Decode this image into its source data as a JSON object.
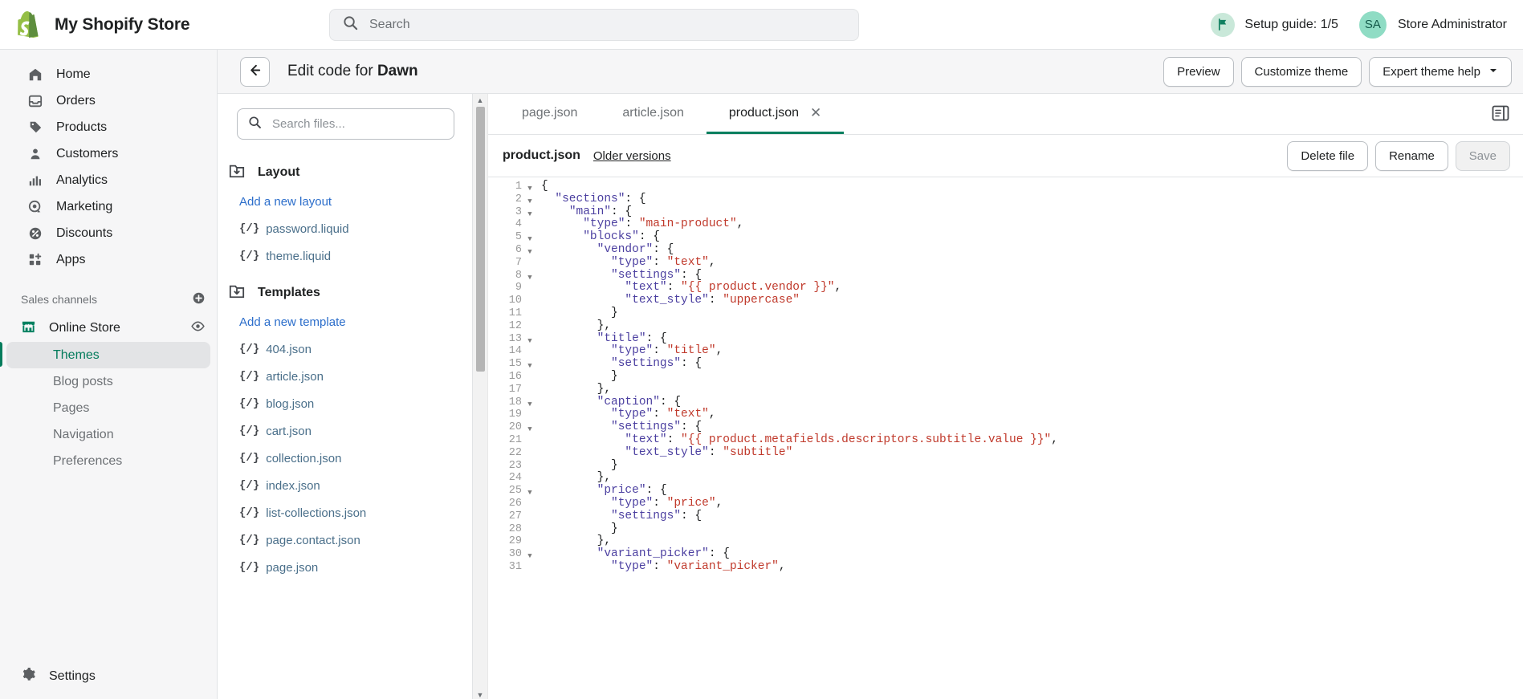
{
  "topbar": {
    "store_name": "My Shopify Store",
    "search_placeholder": "Search",
    "setup_guide_label": "Setup guide: 1/5",
    "avatar_initials": "SA",
    "user_name": "Store Administrator"
  },
  "sidebar": {
    "items": [
      {
        "label": "Home",
        "icon": "home-icon"
      },
      {
        "label": "Orders",
        "icon": "orders-icon"
      },
      {
        "label": "Products",
        "icon": "products-tag-icon"
      },
      {
        "label": "Customers",
        "icon": "customers-icon"
      },
      {
        "label": "Analytics",
        "icon": "analytics-bars-icon"
      },
      {
        "label": "Marketing",
        "icon": "marketing-target-icon"
      },
      {
        "label": "Discounts",
        "icon": "discounts-percent-icon"
      },
      {
        "label": "Apps",
        "icon": "apps-grid-icon"
      }
    ],
    "sales_channels_label": "Sales channels",
    "add_channel_icon": "plus-circle-icon",
    "online_store": {
      "label": "Online Store",
      "icon": "storefront-icon",
      "eye_icon": "eye-icon"
    },
    "sub_items": [
      {
        "label": "Themes",
        "active": true
      },
      {
        "label": "Blog posts",
        "active": false
      },
      {
        "label": "Pages",
        "active": false
      },
      {
        "label": "Navigation",
        "active": false
      },
      {
        "label": "Preferences",
        "active": false
      }
    ],
    "settings": {
      "label": "Settings",
      "icon": "gear-icon"
    }
  },
  "page": {
    "back_icon": "arrow-left-icon",
    "title_prefix": "Edit code for ",
    "title_theme": "Dawn",
    "actions": [
      {
        "label": "Preview",
        "caret": false
      },
      {
        "label": "Customize theme",
        "caret": false
      },
      {
        "label": "Expert theme help",
        "caret": true
      }
    ]
  },
  "filetree": {
    "search_placeholder": "Search files...",
    "search_icon": "search-icon",
    "groups": [
      {
        "name": "Layout",
        "folder_icon": "folder-download-icon",
        "add_label": "Add a new layout",
        "files": [
          "password.liquid",
          "theme.liquid"
        ]
      },
      {
        "name": "Templates",
        "folder_icon": "folder-download-icon",
        "add_label": "Add a new template",
        "files": [
          "404.json",
          "article.json",
          "blog.json",
          "cart.json",
          "collection.json",
          "index.json",
          "list-collections.json",
          "page.contact.json",
          "page.json"
        ]
      }
    ],
    "file_brace": "{/}"
  },
  "editor": {
    "tabs": [
      {
        "label": "page.json",
        "active": false,
        "closable": false
      },
      {
        "label": "article.json",
        "active": false,
        "closable": false
      },
      {
        "label": "product.json",
        "active": true,
        "closable": true
      }
    ],
    "close_icon": "close-icon",
    "expand_icon": "expand-panel-icon",
    "scroll_up_icon": "scroll-up-arrow",
    "scroll_down_icon": "scroll-down-arrow",
    "filename": "product.json",
    "older_versions_label": "Older versions",
    "actions": [
      {
        "label": "Delete file",
        "disabled": false
      },
      {
        "label": "Rename",
        "disabled": false
      },
      {
        "label": "Save",
        "disabled": true
      }
    ],
    "accent_color": "#007f5f",
    "code_lines": [
      {
        "n": 1,
        "fold": true,
        "text": "{"
      },
      {
        "n": 2,
        "fold": true,
        "text": "  \"sections\": {"
      },
      {
        "n": 3,
        "fold": true,
        "text": "    \"main\": {"
      },
      {
        "n": 4,
        "fold": false,
        "text": "      \"type\": \"main-product\","
      },
      {
        "n": 5,
        "fold": true,
        "text": "      \"blocks\": {"
      },
      {
        "n": 6,
        "fold": true,
        "text": "        \"vendor\": {"
      },
      {
        "n": 7,
        "fold": false,
        "text": "          \"type\": \"text\","
      },
      {
        "n": 8,
        "fold": true,
        "text": "          \"settings\": {"
      },
      {
        "n": 9,
        "fold": false,
        "text": "            \"text\": \"{{ product.vendor }}\","
      },
      {
        "n": 10,
        "fold": false,
        "text": "            \"text_style\": \"uppercase\""
      },
      {
        "n": 11,
        "fold": false,
        "text": "          }"
      },
      {
        "n": 12,
        "fold": false,
        "text": "        },"
      },
      {
        "n": 13,
        "fold": true,
        "text": "        \"title\": {"
      },
      {
        "n": 14,
        "fold": false,
        "text": "          \"type\": \"title\","
      },
      {
        "n": 15,
        "fold": true,
        "text": "          \"settings\": {"
      },
      {
        "n": 16,
        "fold": false,
        "text": "          }"
      },
      {
        "n": 17,
        "fold": false,
        "text": "        },"
      },
      {
        "n": 18,
        "fold": true,
        "text": "        \"caption\": {"
      },
      {
        "n": 19,
        "fold": false,
        "text": "          \"type\": \"text\","
      },
      {
        "n": 20,
        "fold": true,
        "text": "          \"settings\": {"
      },
      {
        "n": 21,
        "fold": false,
        "text": "            \"text\": \"{{ product.metafields.descriptors.subtitle.value }}\","
      },
      {
        "n": 22,
        "fold": false,
        "text": "            \"text_style\": \"subtitle\""
      },
      {
        "n": 23,
        "fold": false,
        "text": "          }"
      },
      {
        "n": 24,
        "fold": false,
        "text": "        },"
      },
      {
        "n": 25,
        "fold": true,
        "text": "        \"price\": {"
      },
      {
        "n": 26,
        "fold": false,
        "text": "          \"type\": \"price\","
      },
      {
        "n": 27,
        "fold": false,
        "text": "          \"settings\": {"
      },
      {
        "n": 28,
        "fold": false,
        "text": "          }"
      },
      {
        "n": 29,
        "fold": false,
        "text": "        },"
      },
      {
        "n": 30,
        "fold": true,
        "text": "        \"variant_picker\": {"
      },
      {
        "n": 31,
        "fold": false,
        "text": "          \"type\": \"variant_picker\","
      }
    ]
  }
}
